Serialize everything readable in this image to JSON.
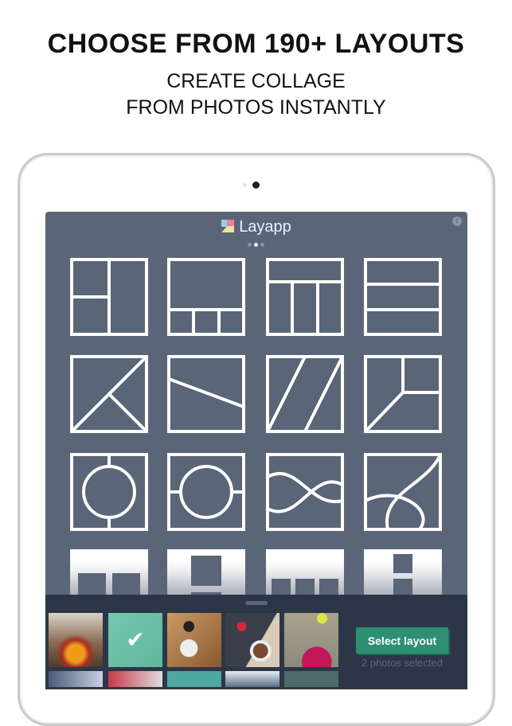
{
  "headline": "CHOOSE FROM 190+ LAYOUTS",
  "subline1": "CREATE COLLAGE",
  "subline2": "FROM PHOTOS INSTANTLY",
  "app": {
    "title": "Layapp",
    "page_dots": 3,
    "active_dot": 1,
    "info_label": "i"
  },
  "bottom": {
    "select_button": "Select layout",
    "status": "2 photos selected"
  },
  "colors": {
    "panel": "#5a6577",
    "bottom": "#2d3646",
    "button": "#2e8f73"
  }
}
